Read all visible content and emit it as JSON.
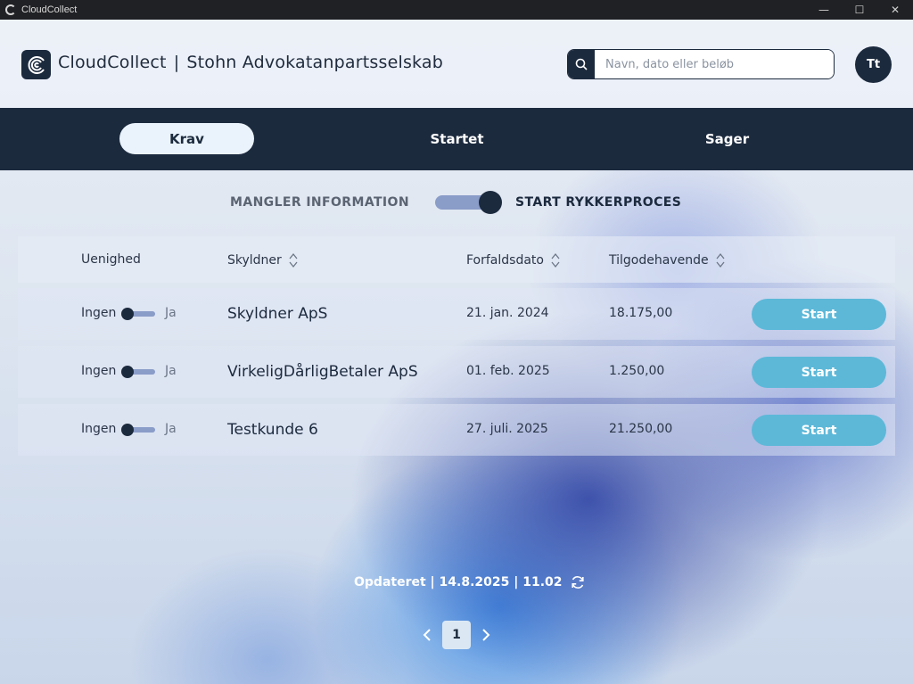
{
  "window": {
    "title": "CloudCollect",
    "controls": [
      "minimize",
      "maximize",
      "close"
    ]
  },
  "header": {
    "brand": "CloudCollect",
    "separator": "|",
    "company": "Stohn Advokatanpartsselskab",
    "search_placeholder": "Navn, dato eller beløb",
    "avatar_initials": "Tt"
  },
  "nav": {
    "tabs": [
      {
        "label": "Krav",
        "active": true
      },
      {
        "label": "Startet",
        "active": false
      },
      {
        "label": "Sager",
        "active": false
      }
    ]
  },
  "mode_toggle": {
    "left_label": "MANGLER INFORMATION",
    "right_label": "START RYKKERPROCES",
    "state": "right"
  },
  "table": {
    "columns": [
      "Uenighed",
      "Skyldner",
      "Forfaldsdato",
      "Tilgodehavende"
    ],
    "rows": [
      {
        "disagree_off": "Ingen",
        "disagree_on": "Ja",
        "debtor": "Skyldner ApS",
        "due_date": "21. jan. 2024",
        "amount": "18.175,00",
        "action": "Start"
      },
      {
        "disagree_off": "Ingen",
        "disagree_on": "Ja",
        "debtor": "VirkeligDårligBetaler ApS",
        "due_date": "01. feb. 2025",
        "amount": "1.250,00",
        "action": "Start"
      },
      {
        "disagree_off": "Ingen",
        "disagree_on": "Ja",
        "debtor": "Testkunde 6",
        "due_date": "27. juli. 2025",
        "amount": "21.250,00",
        "action": "Start"
      }
    ]
  },
  "footer": {
    "updated": "Opdateret | 14.8.2025 | 11.02",
    "current_page": "1"
  },
  "colors": {
    "navy": "#1c2a3e",
    "accent": "#5db8d8",
    "toggle_track": "#8a9cc8"
  }
}
